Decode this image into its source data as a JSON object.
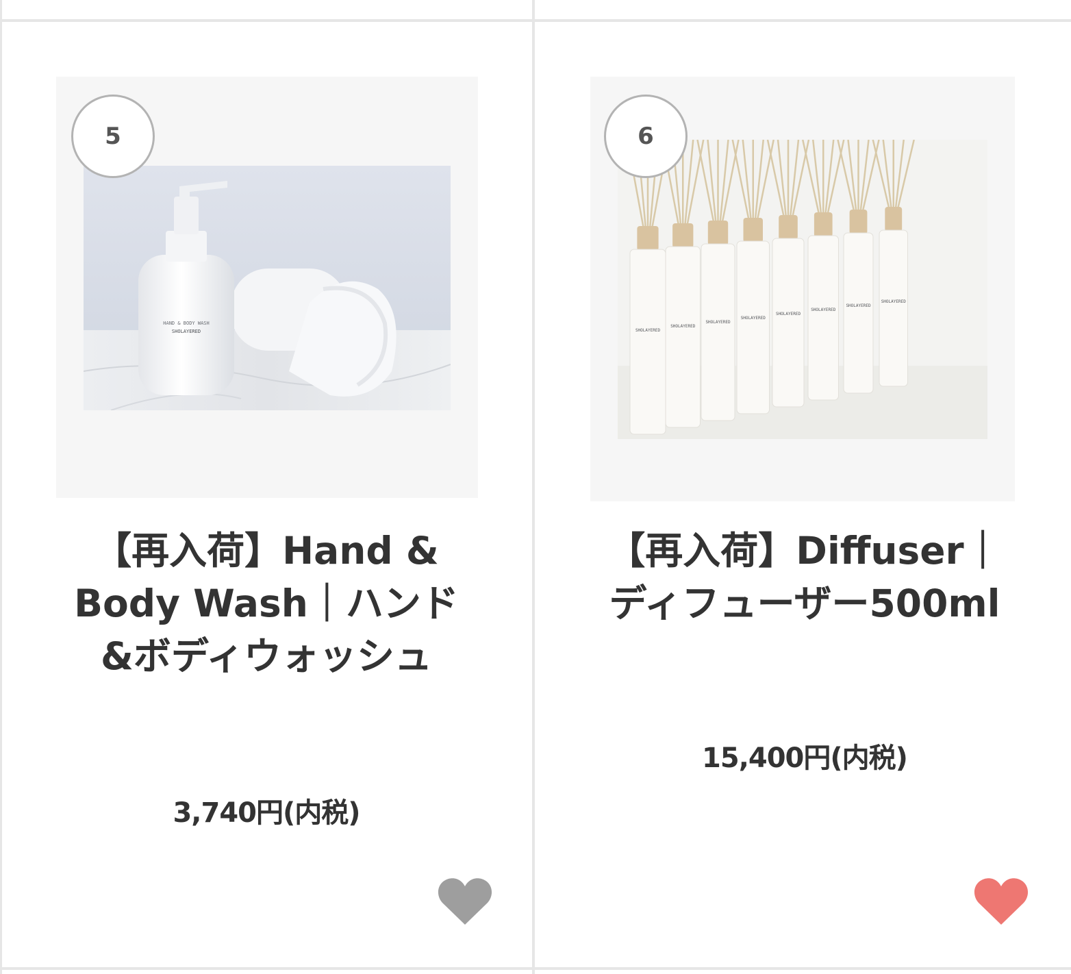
{
  "products": [
    {
      "rank": "5",
      "title": "【再入荷】Hand & Body Wash｜ハンド&ボディウォッシュ",
      "price": "3,740円(内税)",
      "favorite": false,
      "image_alt": "Hand & Body Wash bottle with white towel",
      "bottle_label": "SHOLAYERED",
      "heart_color": "#9e9e9e"
    },
    {
      "rank": "6",
      "title": "【再入荷】Diffuser｜ディフューザー500ml",
      "price": "15,400円(内税)",
      "favorite": true,
      "image_alt": "Row of eight fragrance diffuser bottles with reed sticks",
      "bottle_label": "SHOLAYERED",
      "heart_color": "#ee7772"
    }
  ],
  "colors": {
    "text": "#333333",
    "badge_border": "#b3b3b3",
    "frame_bg": "#f6f6f6",
    "divider": "#e6e6e6"
  }
}
